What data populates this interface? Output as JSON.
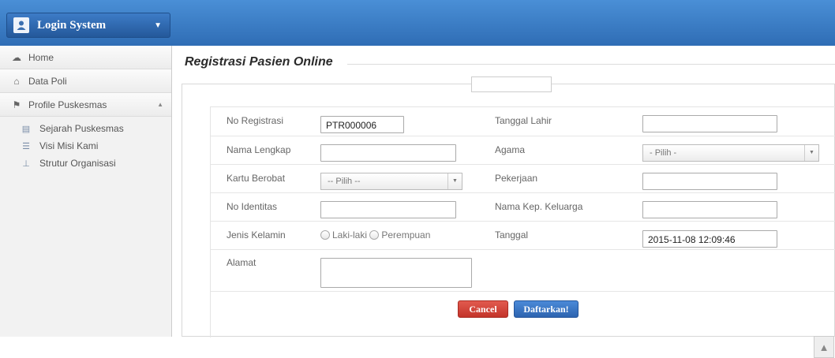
{
  "brand": {
    "title": "Login System",
    "caret": "▼"
  },
  "sidebar": {
    "items": [
      {
        "label": "Home",
        "icon": "dashboard-icon",
        "glyph": "☁"
      },
      {
        "label": "Data Poli",
        "icon": "home-icon",
        "glyph": "⌂"
      },
      {
        "label": "Profile Puskesmas",
        "icon": "flag-icon",
        "glyph": "⚑",
        "arrow": "▲"
      }
    ],
    "subitems": [
      {
        "label": "Sejarah Puskesmas",
        "icon": "list-alt-icon",
        "glyph": "▤"
      },
      {
        "label": "Visi Misi Kami",
        "icon": "list-icon",
        "glyph": "☰"
      },
      {
        "label": "Strutur Organisasi",
        "icon": "sitemap-icon",
        "glyph": "⊥"
      }
    ]
  },
  "page": {
    "title": "Registrasi Pasien Online"
  },
  "form": {
    "no_registrasi": {
      "label": "No Registrasi",
      "value": "PTR000006"
    },
    "tanggal_lahir": {
      "label": "Tanggal Lahir",
      "value": ""
    },
    "nama_lengkap": {
      "label": "Nama Lengkap",
      "value": ""
    },
    "agama": {
      "label": "Agama",
      "value": "- Pilih -"
    },
    "kartu_berobat": {
      "label": "Kartu Berobat",
      "value": "-- Pilih --"
    },
    "pekerjaan": {
      "label": "Pekerjaan",
      "value": ""
    },
    "no_identitas": {
      "label": "No Identitas",
      "value": ""
    },
    "nama_kep_keluarga": {
      "label": "Nama Kep. Keluarga",
      "value": ""
    },
    "jenis_kelamin": {
      "label": "Jenis Kelamin",
      "options": [
        "Laki-laki",
        "Perempuan"
      ]
    },
    "tanggal": {
      "label": "Tanggal",
      "value": "2015-11-08 12:09:46"
    },
    "alamat": {
      "label": "Alamat",
      "value": ""
    }
  },
  "buttons": {
    "cancel": "Cancel",
    "submit": "Daftarkan!"
  },
  "colors": {
    "topbar": "#3a7cc9",
    "cancel": "#d1443a",
    "submit": "#3c78c8"
  }
}
